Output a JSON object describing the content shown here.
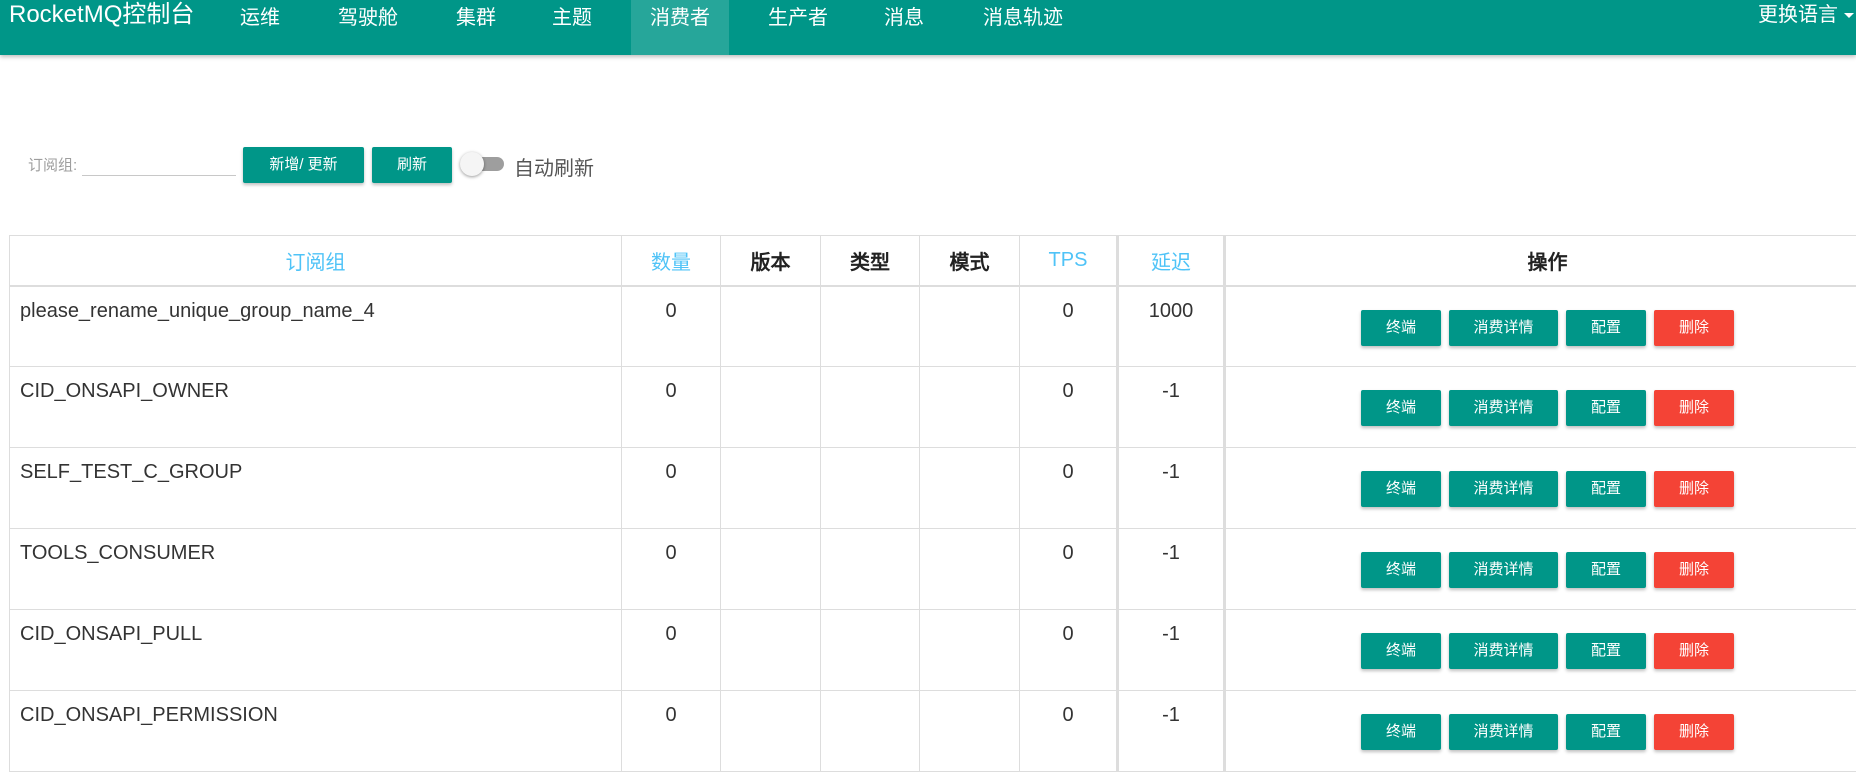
{
  "navbar": {
    "brand": "RocketMQ控制台",
    "items": [
      {
        "label": "运维",
        "active": false
      },
      {
        "label": "驾驶舱",
        "active": false
      },
      {
        "label": "集群",
        "active": false
      },
      {
        "label": "主题",
        "active": false
      },
      {
        "label": "消费者",
        "active": true
      },
      {
        "label": "生产者",
        "active": false
      },
      {
        "label": "消息",
        "active": false
      },
      {
        "label": "消息轨迹",
        "active": false
      }
    ],
    "language": "更换语言",
    "color": "#009688"
  },
  "filter": {
    "label": "订阅组:",
    "value": "",
    "add_update_label": "新增/ 更新",
    "refresh_label": "刷新",
    "auto_refresh_label": "自动刷新",
    "auto_refresh_on": false
  },
  "table": {
    "headers": {
      "group": "订阅组",
      "count": "数量",
      "version": "版本",
      "type": "类型",
      "mode": "模式",
      "tps": "TPS",
      "delay": "延迟",
      "ops": "操作"
    },
    "actions": {
      "terminal": "终端",
      "detail": "消费详情",
      "config": "配置",
      "delete": "删除"
    },
    "rows": [
      {
        "group": "please_rename_unique_group_name_4",
        "count": "0",
        "version": "",
        "type": "",
        "mode": "",
        "tps": "0",
        "delay": "1000"
      },
      {
        "group": "CID_ONSAPI_OWNER",
        "count": "0",
        "version": "",
        "type": "",
        "mode": "",
        "tps": "0",
        "delay": "-1"
      },
      {
        "group": "SELF_TEST_C_GROUP",
        "count": "0",
        "version": "",
        "type": "",
        "mode": "",
        "tps": "0",
        "delay": "-1"
      },
      {
        "group": "TOOLS_CONSUMER",
        "count": "0",
        "version": "",
        "type": "",
        "mode": "",
        "tps": "0",
        "delay": "-1"
      },
      {
        "group": "CID_ONSAPI_PULL",
        "count": "0",
        "version": "",
        "type": "",
        "mode": "",
        "tps": "0",
        "delay": "-1"
      },
      {
        "group": "CID_ONSAPI_PERMISSION",
        "count": "0",
        "version": "",
        "type": "",
        "mode": "",
        "tps": "0",
        "delay": "-1"
      }
    ]
  }
}
